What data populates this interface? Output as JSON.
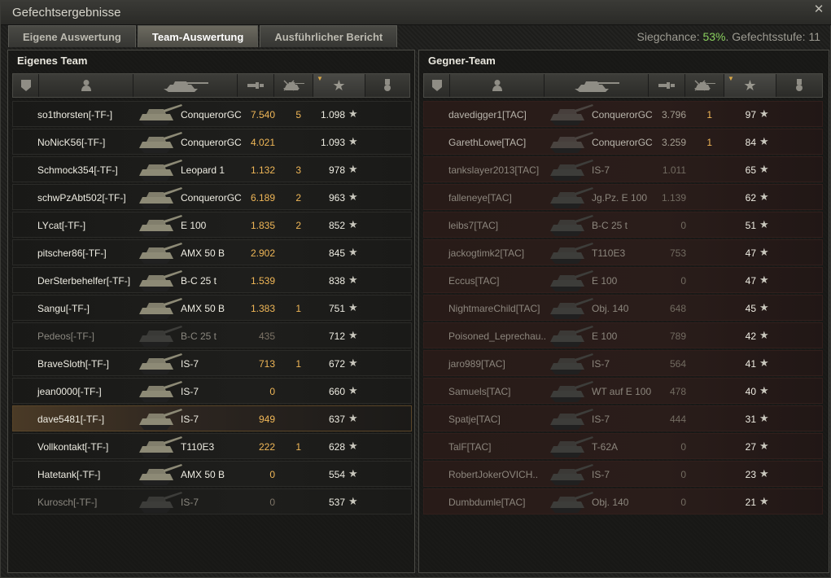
{
  "window": {
    "title": "Gefechtsergebnisse"
  },
  "tabs": [
    {
      "label": "Eigene Auswertung"
    },
    {
      "label": "Team-Auswertung"
    },
    {
      "label": "Ausführlicher Bericht"
    }
  ],
  "meta": {
    "win_label": "Siegchance:",
    "win_value": "53%",
    "tier_label": ". Gefechtsstufe: 11"
  },
  "own_team": {
    "title": "Eigenes Team",
    "rows": [
      {
        "name": "so1thorsten[-TF-]",
        "tank": "ConquerorGC",
        "damage": "7.540",
        "kills": "5",
        "xp": "1.098"
      },
      {
        "name": "NoNicK56[-TF-]",
        "tank": "ConquerorGC",
        "damage": "4.021",
        "kills": "",
        "xp": "1.093"
      },
      {
        "name": "Schmock354[-TF-]",
        "tank": "Leopard 1",
        "damage": "1.132",
        "kills": "3",
        "xp": "978"
      },
      {
        "name": "schwPzAbt502[-TF-]",
        "tank": "ConquerorGC",
        "damage": "6.189",
        "kills": "2",
        "xp": "963"
      },
      {
        "name": "LYcat[-TF-]",
        "tank": "E 100",
        "damage": "1.835",
        "kills": "2",
        "xp": "852"
      },
      {
        "name": "pitscher86[-TF-]",
        "tank": "AMX 50 B",
        "damage": "2.902",
        "kills": "",
        "xp": "845"
      },
      {
        "name": "DerSterbehelfer[-TF-]",
        "tank": "B-C 25 t",
        "damage": "1.539",
        "kills": "",
        "xp": "838"
      },
      {
        "name": "Sangu[-TF-]",
        "tank": "AMX 50 B",
        "damage": "1.383",
        "kills": "1",
        "xp": "751"
      },
      {
        "name": "Pedeos[-TF-]",
        "tank": "B-C 25 t",
        "damage": "435",
        "kills": "",
        "xp": "712"
      },
      {
        "name": "BraveSloth[-TF-]",
        "tank": "IS-7",
        "damage": "713",
        "kills": "1",
        "xp": "672"
      },
      {
        "name": "jean0000[-TF-]",
        "tank": "IS-7",
        "damage": "0",
        "kills": "",
        "xp": "660"
      },
      {
        "name": "dave5481[-TF-]",
        "tank": "IS-7",
        "damage": "949",
        "kills": "",
        "xp": "637"
      },
      {
        "name": "Vollkontakt[-TF-]",
        "tank": "T110E3",
        "damage": "222",
        "kills": "1",
        "xp": "628"
      },
      {
        "name": "Hatetank[-TF-]",
        "tank": "AMX 50 B",
        "damage": "0",
        "kills": "",
        "xp": "554"
      },
      {
        "name": "Kurosch[-TF-]",
        "tank": "IS-7",
        "damage": "0",
        "kills": "",
        "xp": "537"
      }
    ]
  },
  "enemy_team": {
    "title": "Gegner-Team",
    "rows": [
      {
        "name": "davedigger1[TAC]",
        "tank": "ConquerorGC",
        "damage": "3.796",
        "kills": "1",
        "xp": "97"
      },
      {
        "name": "GarethLowe[TAC]",
        "tank": "ConquerorGC",
        "damage": "3.259",
        "kills": "1",
        "xp": "84"
      },
      {
        "name": "tankslayer2013[TAC]",
        "tank": "IS-7",
        "damage": "1.011",
        "kills": "",
        "xp": "65"
      },
      {
        "name": "falleneye[TAC]",
        "tank": "Jg.Pz. E 100",
        "damage": "1.139",
        "kills": "",
        "xp": "62"
      },
      {
        "name": "leibs7[TAC]",
        "tank": "B-C 25 t",
        "damage": "0",
        "kills": "",
        "xp": "51"
      },
      {
        "name": "jackogtimk2[TAC]",
        "tank": "T110E3",
        "damage": "753",
        "kills": "",
        "xp": "47"
      },
      {
        "name": "Eccus[TAC]",
        "tank": "E 100",
        "damage": "0",
        "kills": "",
        "xp": "47"
      },
      {
        "name": "NightmareChild[TAC]",
        "tank": "Obj. 140",
        "damage": "648",
        "kills": "",
        "xp": "45"
      },
      {
        "name": "Poisoned_Leprechau..",
        "tank": "E 100",
        "damage": "789",
        "kills": "",
        "xp": "42"
      },
      {
        "name": "jaro989[TAC]",
        "tank": "IS-7",
        "damage": "564",
        "kills": "",
        "xp": "41"
      },
      {
        "name": "Samuels[TAC]",
        "tank": "WT auf E 100",
        "damage": "478",
        "kills": "",
        "xp": "40"
      },
      {
        "name": "Spatje[TAC]",
        "tank": "IS-7",
        "damage": "444",
        "kills": "",
        "xp": "31"
      },
      {
        "name": "TalF[TAC]",
        "tank": "T-62A",
        "damage": "0",
        "kills": "",
        "xp": "27"
      },
      {
        "name": "RobertJokerOVICH..",
        "tank": "IS-7",
        "damage": "0",
        "kills": "",
        "xp": "23"
      },
      {
        "name": "Dumbdumle[TAC]",
        "tank": "Obj. 140",
        "damage": "0",
        "kills": "",
        "xp": "21"
      }
    ]
  },
  "colors": {
    "accent": "#f0b757",
    "win_green": "#8bd15f",
    "enemy_row": "#2a1d1a"
  },
  "icons": {
    "close": "close-icon",
    "star": "star-icon",
    "rank": "rank-icon",
    "player": "player-icon",
    "tank": "tank-icon",
    "damage": "damage-icon",
    "kills": "kills-icon",
    "medal": "medal-icon"
  }
}
